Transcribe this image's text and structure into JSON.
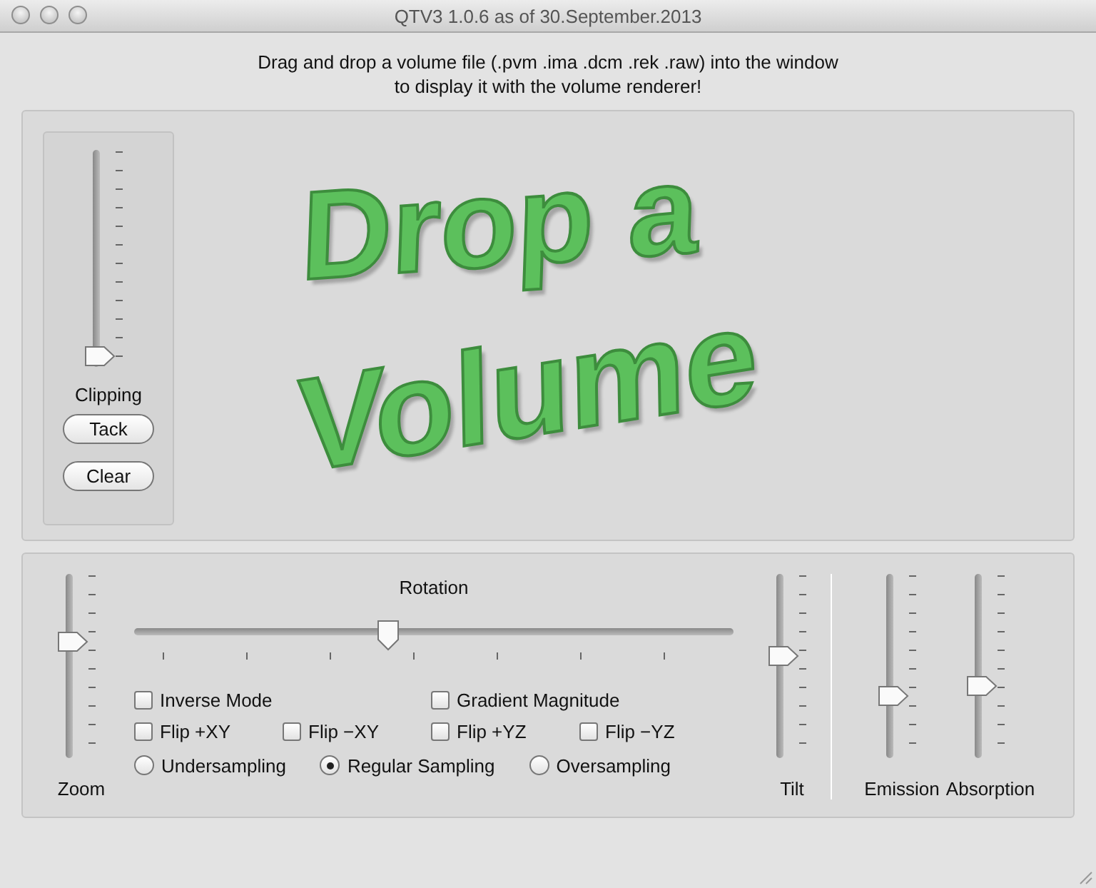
{
  "window": {
    "title": "QTV3 1.0.6 as of 30.September.2013"
  },
  "instructions": [
    "Drag and drop a volume file (.pvm .ima .dcm .rek .raw) into the window",
    "to display it with the volume renderer!"
  ],
  "viewport": {
    "caption_lines": [
      "Drop a",
      "Volume"
    ]
  },
  "clipping": {
    "label": "Clipping",
    "level": 0,
    "buttons": [
      "Tack",
      "Clear"
    ]
  },
  "zoom": {
    "label": "Zoom",
    "level": 0.65
  },
  "rotation": {
    "label": "Rotation",
    "level": 0.42
  },
  "option_rows": [
    [
      {
        "label": "Inverse Mode",
        "checked": false
      },
      {
        "label": "Gradient Magnitude",
        "checked": false
      }
    ],
    [
      {
        "label": "Flip +XY",
        "checked": false
      },
      {
        "label": "Flip −XY",
        "checked": false
      },
      {
        "label": "Flip +YZ",
        "checked": false
      },
      {
        "label": "Flip −YZ",
        "checked": false
      }
    ]
  ],
  "sampling": [
    {
      "label": "Undersampling",
      "selected": false
    },
    {
      "label": "Regular Sampling",
      "selected": true
    },
    {
      "label": "Oversampling",
      "selected": false
    }
  ],
  "tilt": {
    "label": "Tilt",
    "level": 0.56
  },
  "emission": {
    "label": "Emission",
    "level": 0.32
  },
  "absorption": {
    "label": "Absorption",
    "level": 0.38
  }
}
